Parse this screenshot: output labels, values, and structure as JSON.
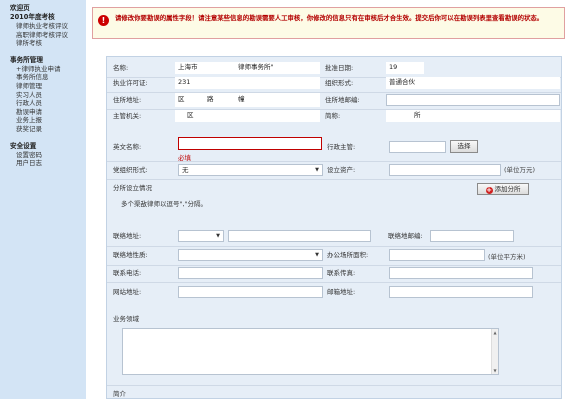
{
  "sidebar": {
    "welcome": "欢迎页",
    "section1_title": "2010年度考核",
    "section1_items": [
      "律师执业考核评议",
      "高职律师考核评议",
      "律所考核"
    ],
    "section2_title": "事务所管理",
    "section2_items": [
      "+律师执业申请",
      "事务所信息",
      "律师管理",
      "实习人员",
      "行政人员",
      "勘误申请",
      "业务上报",
      "获奖记录"
    ],
    "section3_title": "安全设置",
    "section3_items": [
      "设置密码",
      "用户日志"
    ]
  },
  "notice": {
    "text": "请修改你要勘误的属性字段！请注意某些信息的勘误需要人工审核，你修改的信息只有在审核后才合生效。提交后你可以在勘误列表里查看勘误的状态。"
  },
  "form": {
    "name_label": "名称:",
    "name_value_prefix": "上海市",
    "name_value_suffix": "律师事务所\"",
    "approve_date_label": "批准日期:",
    "approve_date_value": "19",
    "license_label": "执业许可证:",
    "license_value": "231",
    "org_form_label": "组织形式:",
    "org_form_value": "普通合伙",
    "address_label": "住所地址:",
    "address_value_district": "区",
    "address_value_road": "路",
    "address_value_no": "幢",
    "address_zip_label": "住所地邮编:",
    "authority_label": "主管机关:",
    "authority_value": "区",
    "short_name_label": "简称:",
    "short_name_value": "所",
    "english_name_label": "英文名称:",
    "required_text": "必填",
    "admin_head_label": "行政主管:",
    "select_button": "选择",
    "branch_form_label": "党组织形式:",
    "branch_form_value": "无",
    "assets_label": "设立资产:",
    "assets_unit": "(单位万元)",
    "branch_label": "分所设立情况",
    "add_branch_button": "添加分所",
    "multi_hint": "多个渠敌律师以逗号\",\"分隔。",
    "contact_address_label": "联络地址:",
    "contact_zip_label": "联络地邮编:",
    "contact_nature_label": "联络地性质:",
    "office_area_label": "办公场所面积:",
    "area_unit": "(单位平方米)",
    "phone_label": "联系电话:",
    "fax_label": "联系传真:",
    "website_label": "网站地址:",
    "email_label": "邮箱地址:",
    "business_label": "业务领域",
    "intro_label": "简介"
  }
}
